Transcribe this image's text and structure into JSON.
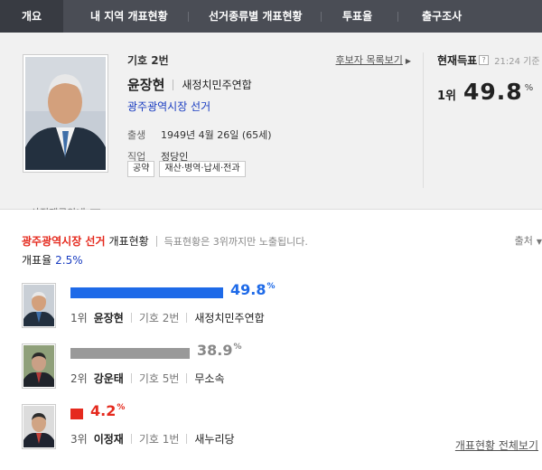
{
  "nav": {
    "tabs": [
      {
        "label": "개요",
        "active": true
      },
      {
        "label": "내 지역 개표현황"
      },
      {
        "label": "선거종류별 개표현황"
      },
      {
        "label": "투표율"
      },
      {
        "label": "출구조사"
      }
    ]
  },
  "candidate": {
    "photo_guide": "사진제공안내",
    "number_label": "기호 2번",
    "name": "윤장현",
    "party": "새정치민주연합",
    "election": "광주광역시장 선거",
    "birth_key": "출생",
    "birth_value": "1949년 4월 26일 (65세)",
    "job_key": "직업",
    "job_value": "정당인",
    "buttons": [
      "공약",
      "재산·병역·납세·전과"
    ],
    "list_link": "후보자 목록보기"
  },
  "current": {
    "title": "현재득표",
    "time": "21:24 기준",
    "rank": "1위",
    "percent": "49.8",
    "unit": "%"
  },
  "status": {
    "election": "광주광역시장 선거",
    "title": "개표현황",
    "note": "득표현황은 3위까지만 노출됩니다.",
    "source": "출처",
    "count_rate_label": "개표율",
    "count_rate_value": "2.5%",
    "results": [
      {
        "percent": "49.8",
        "unit": "%",
        "share": 0.498,
        "color": "#1e6ae8",
        "rank": "1위",
        "name": "윤장현",
        "number": "기호 2번",
        "party": "새정치민주연합"
      },
      {
        "percent": "38.9",
        "unit": "%",
        "share": 0.389,
        "color": "#999999",
        "rank": "2위",
        "name": "강운태",
        "number": "기호 5번",
        "party": "무소속"
      },
      {
        "percent": "4.2",
        "unit": "%",
        "share": 0.042,
        "color": "#e52a1e",
        "rank": "3위",
        "name": "이정재",
        "number": "기호 1번",
        "party": "새누리당"
      }
    ],
    "all_link": "개표현황 전체보기"
  }
}
